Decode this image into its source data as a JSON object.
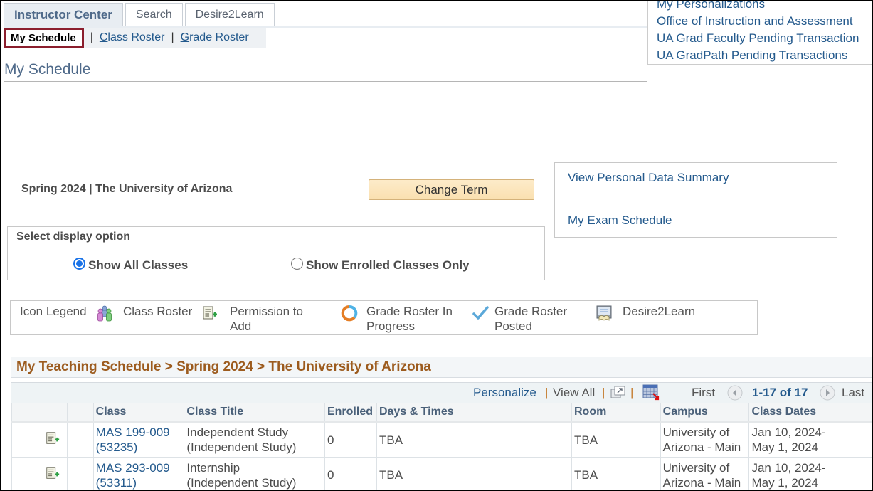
{
  "tabs": [
    {
      "label": "Instructor Center",
      "active": true
    },
    {
      "label_pre": "Searc",
      "label_ul": "h",
      "active": false
    },
    {
      "label": "Desire2Learn",
      "active": false
    }
  ],
  "subnav": {
    "current": "My Schedule",
    "separator": "|",
    "class_roster_ul": "C",
    "class_roster_rest": "lass Roster",
    "grade_roster_ul": "G",
    "grade_roster_rest": "rade Roster"
  },
  "page_title": "My Schedule",
  "right_menu": [
    "My Personalizations",
    "Office of Instruction and Assessment",
    "UA Grad Faculty Pending Transaction",
    "UA GradPath Pending Transactions"
  ],
  "term": {
    "label": "Spring 2024 | The University of Arizona",
    "change_button": "Change Term"
  },
  "side_links": {
    "personal_data": "View Personal Data Summary",
    "exam_schedule": "My Exam Schedule"
  },
  "display_option": {
    "header": "Select display option",
    "options": [
      {
        "label": "Show All Classes",
        "selected": true
      },
      {
        "label": "Show Enrolled Classes Only",
        "selected": false
      }
    ]
  },
  "legend": {
    "title": "Icon Legend",
    "items": [
      {
        "icon": "class-roster-icon",
        "label": "Class Roster"
      },
      {
        "icon": "permission-to-add-icon",
        "label_l1": "Permission to",
        "label_l2": "Add"
      },
      {
        "icon": "grade-roster-in-progress-icon",
        "label_l1": "Grade Roster In",
        "label_l2": "Progress"
      },
      {
        "icon": "grade-roster-posted-icon",
        "label_l1": "Grade Roster",
        "label_l2": "Posted"
      },
      {
        "icon": "desire2learn-icon",
        "label": "Desire2Learn"
      }
    ]
  },
  "grid": {
    "title": "My Teaching Schedule > Spring 2024 > The University of Arizona",
    "nav": {
      "personalize": "Personalize",
      "sep": "|",
      "view_all": "View All",
      "first": "First",
      "range": "1-17 of 17",
      "last": "Last"
    },
    "columns": [
      "",
      "",
      "",
      "Class",
      "Class Title",
      "Enrolled",
      "Days & Times",
      "Room",
      "Campus",
      "Class Dates"
    ],
    "rows": [
      {
        "class_l1": "MAS 199-009",
        "class_l2": "(53235)",
        "title_l1": "Independent Study",
        "title_l2": "(Independent Study)",
        "enrolled": "0",
        "days_times": "TBA",
        "room": "TBA",
        "campus_l1": "University of",
        "campus_l2": "Arizona - Main",
        "dates_l1": "Jan 10, 2024-",
        "dates_l2": "May 1, 2024"
      },
      {
        "class_l1": "MAS 293-009",
        "class_l2": "(53311)",
        "title_l1": "Internship",
        "title_l2": "(Independent Study)",
        "enrolled": "0",
        "days_times": "TBA",
        "room": "TBA",
        "campus_l1": "University of",
        "campus_l2": "Arizona - Main",
        "dates_l1": "Jan 10, 2024-",
        "dates_l2": "May 1, 2024"
      }
    ]
  },
  "colors": {
    "link": "#245a8d",
    "grid_title": "#9c5b1e",
    "current_highlight": "#8b1e2d",
    "button_bg": "#fae0b0"
  }
}
